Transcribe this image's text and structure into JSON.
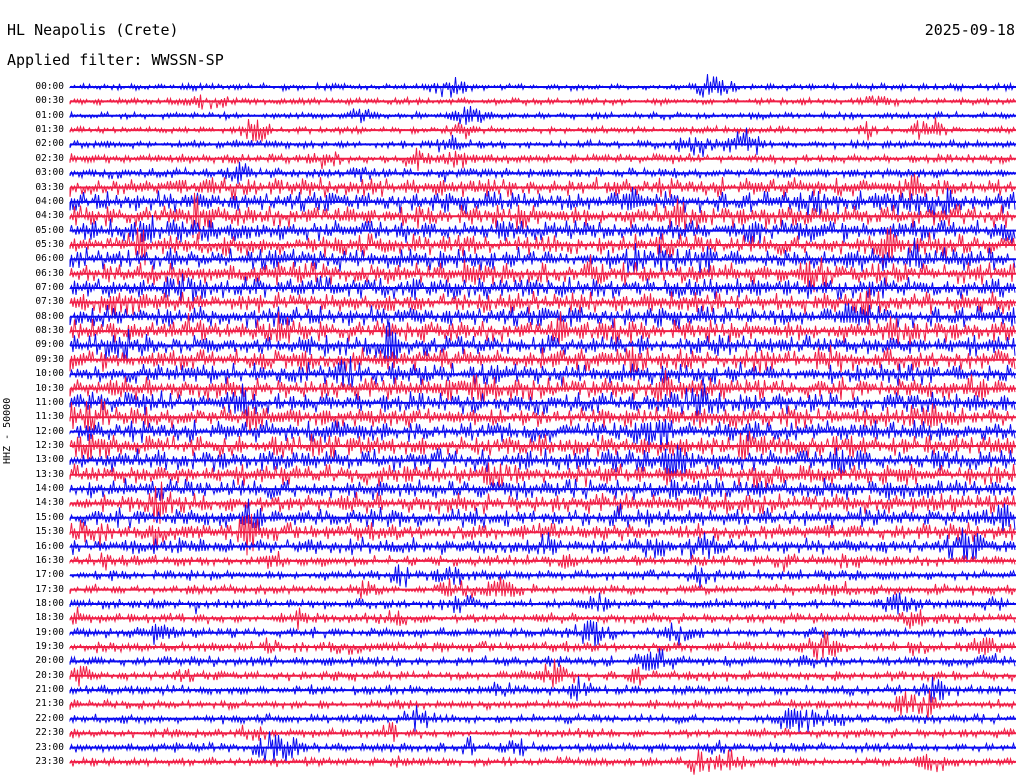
{
  "header": {
    "station": "HL Neapolis (Crete)",
    "date": "2025-09-18",
    "filter_line": "Applied filter: WWSSN-SP"
  },
  "channel": {
    "label": "HHZ - 50000"
  },
  "colors": {
    "trace_a": "#0a0af0",
    "trace_b": "#f01e46",
    "background": "#ffffff",
    "text": "#000000"
  },
  "chart_data": {
    "type": "line",
    "title": "HL Neapolis (Crete)",
    "xlabel": "",
    "ylabel": "HHZ - 50000",
    "grid": false,
    "legend": "none",
    "categories": [
      "00:00",
      "00:30",
      "01:00",
      "01:30",
      "02:00",
      "02:30",
      "03:00",
      "03:30",
      "04:00",
      "04:30",
      "05:00",
      "05:30",
      "06:00",
      "06:30",
      "07:00",
      "07:30",
      "08:00",
      "08:30",
      "09:00",
      "09:30",
      "10:00",
      "10:30",
      "11:00",
      "11:30",
      "12:00",
      "12:30",
      "13:00",
      "13:30",
      "14:00",
      "14:30",
      "15:00",
      "15:30",
      "16:00",
      "16:30",
      "17:00",
      "17:30",
      "18:00",
      "18:30",
      "19:00",
      "19:30",
      "20:00",
      "20:30",
      "21:00",
      "21:30",
      "22:00",
      "22:30",
      "23:00",
      "23:30"
    ],
    "activity_level": [
      0.1,
      0.12,
      0.1,
      0.12,
      0.22,
      0.25,
      0.3,
      0.85,
      1.0,
      1.0,
      1.0,
      1.0,
      1.0,
      1.0,
      1.0,
      1.0,
      1.0,
      1.0,
      1.0,
      1.0,
      1.0,
      1.0,
      1.0,
      1.0,
      1.0,
      1.0,
      1.0,
      1.0,
      0.95,
      0.9,
      0.85,
      0.8,
      0.7,
      0.35,
      0.3,
      0.3,
      0.3,
      0.3,
      0.32,
      0.35,
      0.32,
      0.3,
      0.28,
      0.25,
      0.25,
      0.25,
      0.25,
      0.25
    ]
  }
}
